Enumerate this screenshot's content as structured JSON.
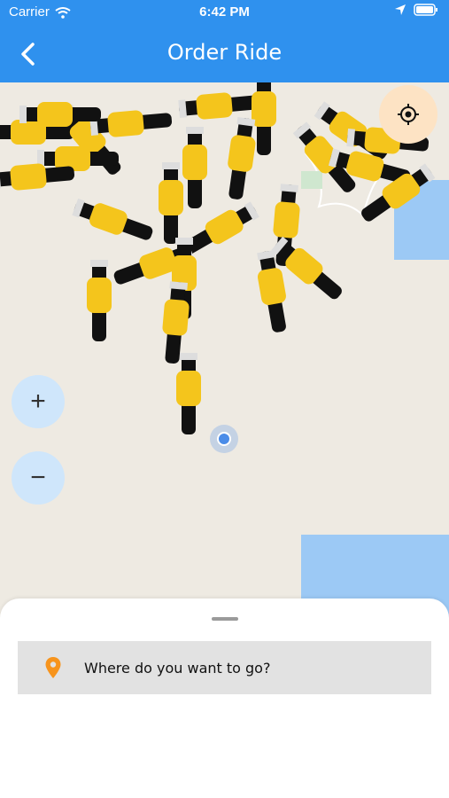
{
  "status_bar": {
    "carrier": "Carrier",
    "time": "6:42 PM"
  },
  "header": {
    "title": "Order Ride",
    "back_icon": "chevron-left-icon",
    "color": "#2f91ee"
  },
  "map": {
    "controls": {
      "locate_icon": "crosshair-icon",
      "zoom_in": "+",
      "zoom_out": "−"
    },
    "user_location": "current-location-dot",
    "scooter_count": 26
  },
  "bottom_sheet": {
    "search_placeholder": "Where do you want to go?",
    "pin_icon": "location-pin-icon",
    "pin_color": "#f7941d"
  }
}
